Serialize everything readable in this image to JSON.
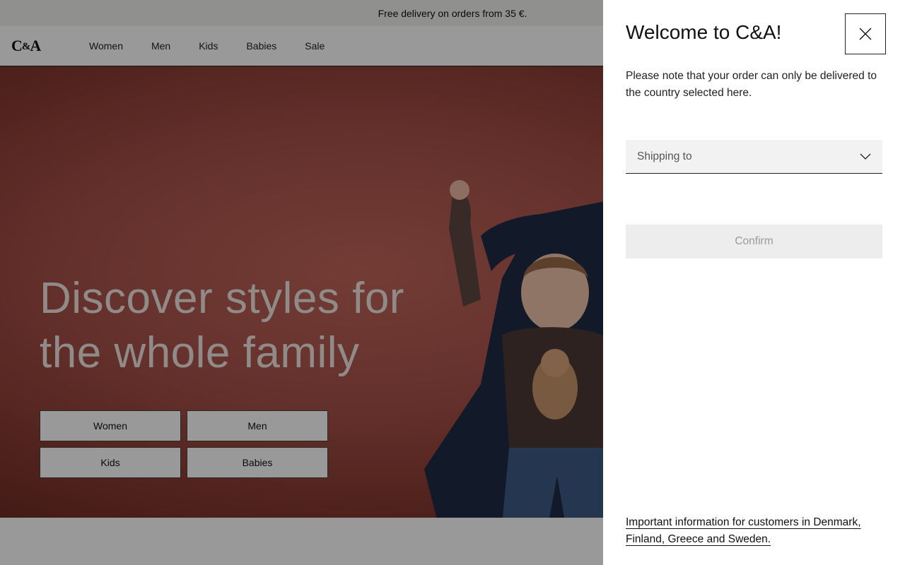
{
  "promo": {
    "text": "Free delivery on orders from 35 €."
  },
  "header": {
    "logo": {
      "main": "C",
      "amp": "&",
      "tail": "A"
    },
    "nav": [
      {
        "label": "Women"
      },
      {
        "label": "Men"
      },
      {
        "label": "Kids"
      },
      {
        "label": "Babies"
      },
      {
        "label": "Sale"
      }
    ]
  },
  "hero": {
    "title_line1": "Discover styles for",
    "title_line2": "the whole family",
    "buttons": [
      {
        "label": "Women"
      },
      {
        "label": "Men"
      },
      {
        "label": "Kids"
      },
      {
        "label": "Babies"
      }
    ],
    "photo_icon": "parent-and-child-photo"
  },
  "drawer": {
    "title": "Welcome to C&A!",
    "close_icon": "close-icon",
    "note": "Please note that your order can only be delivered to the country selected here.",
    "shipping": {
      "label": "Shipping to",
      "icon": "chevron-down-icon"
    },
    "confirm_label": "Confirm",
    "info_link": "Important information for customers in Denmark, Finland, Greece and Sweden."
  },
  "colors": {
    "hero_bg": "#a9524a",
    "overlay": "rgba(0,0,0,0.40)",
    "confirm_disabled_bg": "#ededed",
    "confirm_disabled_text": "#9a9a9a"
  }
}
